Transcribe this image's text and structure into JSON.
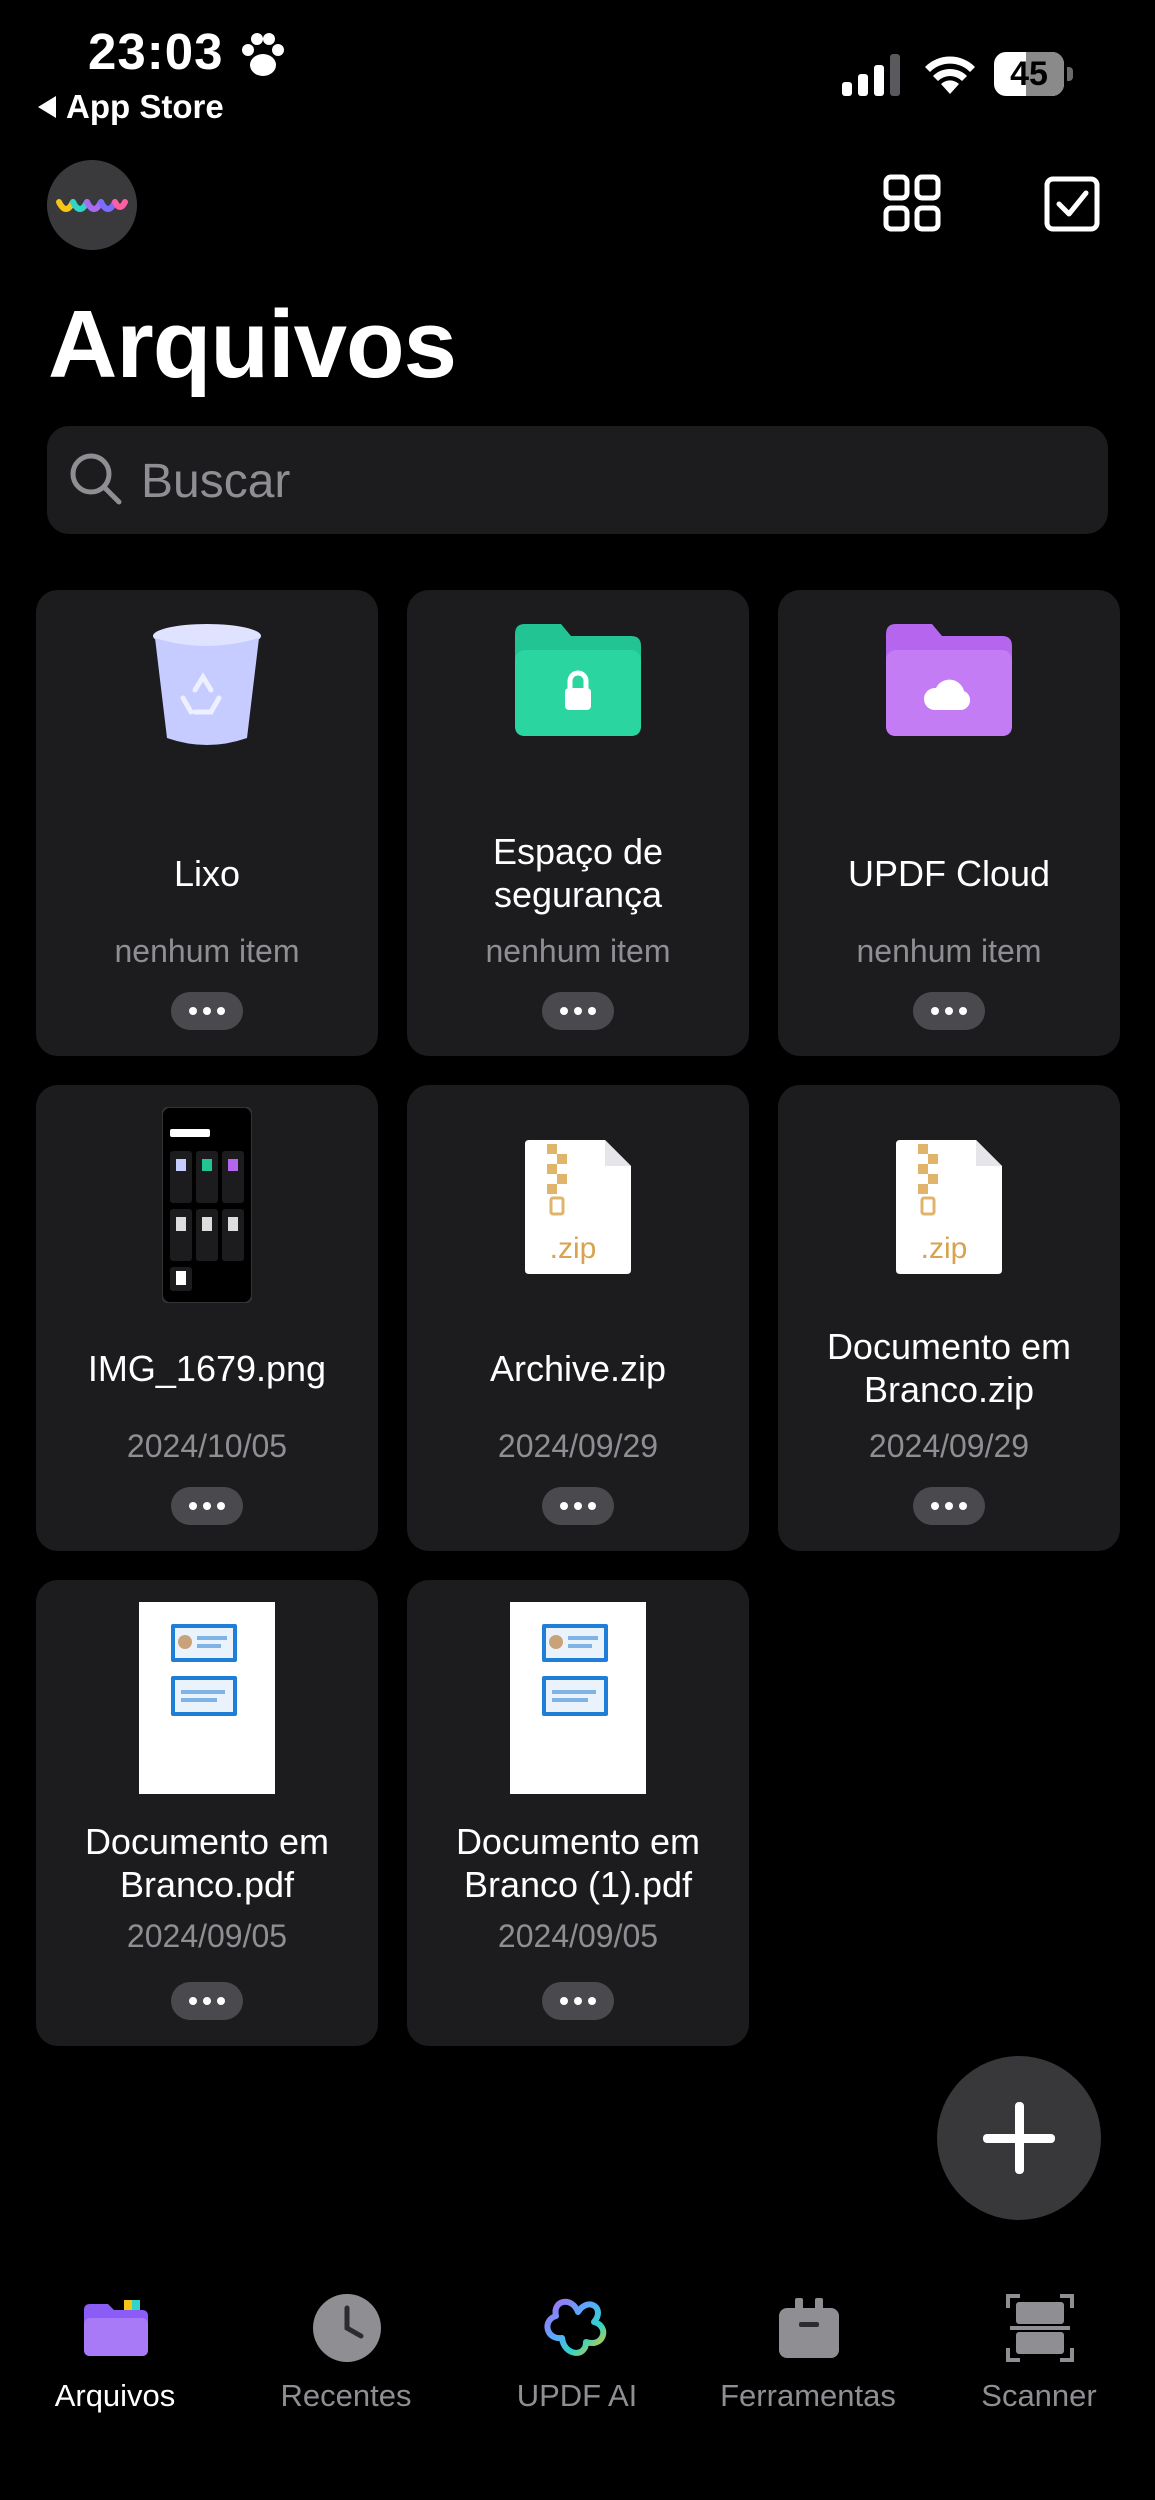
{
  "status_bar": {
    "time": "23:03",
    "back_label": "App Store",
    "battery": "45",
    "battery_level": 0.45
  },
  "header": {
    "title": "Arquivos",
    "icons": [
      "grid-view-icon",
      "select-checkbox-icon"
    ]
  },
  "search": {
    "placeholder": "Buscar"
  },
  "items": [
    {
      "name": "Lixo",
      "sub": "nenhum item",
      "icon": "trash-icon"
    },
    {
      "name": "Espaço de segurança",
      "sub": "nenhum item",
      "icon": "secure-folder-icon",
      "color": "#22c493"
    },
    {
      "name": "UPDF Cloud",
      "sub": "nenhum item",
      "icon": "cloud-folder-icon",
      "color": "#b565ee"
    },
    {
      "name": "IMG_1679.png",
      "sub": "2024/10/05",
      "icon": "image-thumbnail"
    },
    {
      "name": "Archive.zip",
      "sub": "2024/09/29",
      "icon": "zip-file-icon",
      "ext": ".zip"
    },
    {
      "name": "Documento em Branco.zip",
      "sub": "2024/09/29",
      "icon": "zip-file-icon",
      "ext": ".zip"
    },
    {
      "name": "Documento em Branco.pdf",
      "sub": "2024/09/05",
      "icon": "pdf-thumbnail"
    },
    {
      "name": "Documento em Branco (1).pdf",
      "sub": "2024/09/05",
      "icon": "pdf-thumbnail"
    }
  ],
  "tabs": [
    {
      "label": "Arquivos",
      "icon": "folder-icon",
      "active": true
    },
    {
      "label": "Recentes",
      "icon": "clock-icon"
    },
    {
      "label": "UPDF AI",
      "icon": "ai-icon"
    },
    {
      "label": "Ferramentas",
      "icon": "toolbox-icon"
    },
    {
      "label": "Scanner",
      "icon": "scanner-icon"
    }
  ],
  "fab": {
    "icon": "plus-icon"
  }
}
